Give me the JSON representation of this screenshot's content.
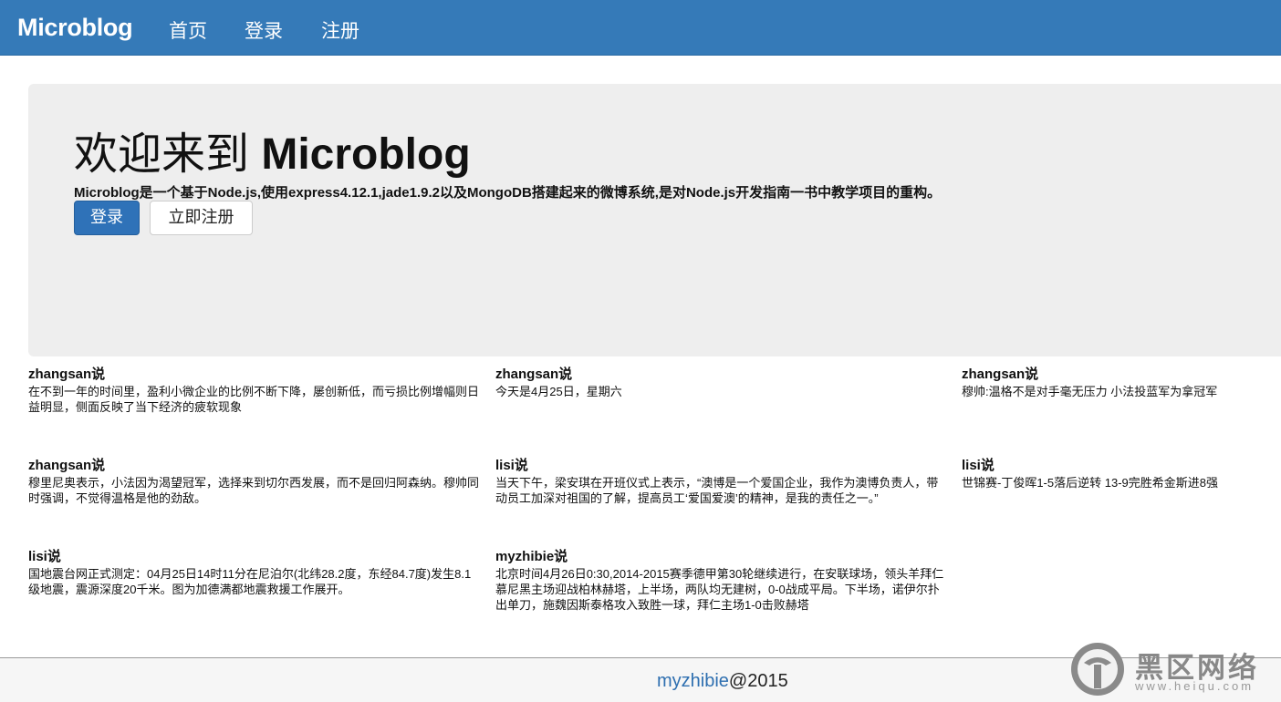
{
  "navbar": {
    "brand": "Microblog",
    "items": [
      {
        "label": "首页"
      },
      {
        "label": "登录"
      },
      {
        "label": "注册"
      }
    ]
  },
  "hero": {
    "title_prefix": "欢迎来到 ",
    "title_brand": "Microblog",
    "description": "Microblog是一个基于Node.js,使用express4.12.1,jade1.9.2以及MongoDB搭建起来的微博系统,是对Node.js开发指南一书中教学项目的重构。",
    "login_button": "登录",
    "register_button": "立即注册"
  },
  "posts": [
    {
      "author": "zhangsan说",
      "content": "在不到一年的时间里，盈利小微企业的比例不断下降，屡创新低，而亏损比例增幅则日益明显，侧面反映了当下经济的疲软现象"
    },
    {
      "author": "zhangsan说",
      "content": "今天是4月25日，星期六"
    },
    {
      "author": "zhangsan说",
      "content": "穆帅:温格不是对手毫无压力 小法投蓝军为拿冠军"
    },
    {
      "author": "zhangsan说",
      "content": "穆里尼奥表示，小法因为渴望冠军，选择来到切尔西发展，而不是回归阿森纳。穆帅同时强调，不觉得温格是他的劲敌。"
    },
    {
      "author": "lisi说",
      "content": "当天下午，梁安琪在开班仪式上表示，“澳博是一个爱国企业，我作为澳博负责人，带动员工加深对祖国的了解，提高员工‘爱国爱澳’的精神，是我的责任之一。”"
    },
    {
      "author": "lisi说",
      "content": "世锦赛-丁俊晖1-5落后逆转 13-9完胜希金斯进8强"
    },
    {
      "author": "lisi说",
      "content": "国地震台网正式测定：04月25日14时11分在尼泊尔(北纬28.2度，东经84.7度)发生8.1级地震，震源深度20千米。图为加德满都地震救援工作展开。"
    },
    {
      "author": "myzhibie说",
      "content": "北京时间4月26日0:30,2014-2015赛季德甲第30轮继续进行，在安联球场，领头羊拜仁慕尼黑主场迎战柏林赫塔，上半场，两队均无建树，0-0战成平局。下半场，诺伊尔扑出单刀，施魏因斯泰格攻入致胜一球，拜仁主场1-0击败赫塔"
    }
  ],
  "footer": {
    "link": "myzhibie",
    "suffix": "@2015"
  },
  "watermark": {
    "title": "黑区网络",
    "url": "www.heiqu.com"
  }
}
